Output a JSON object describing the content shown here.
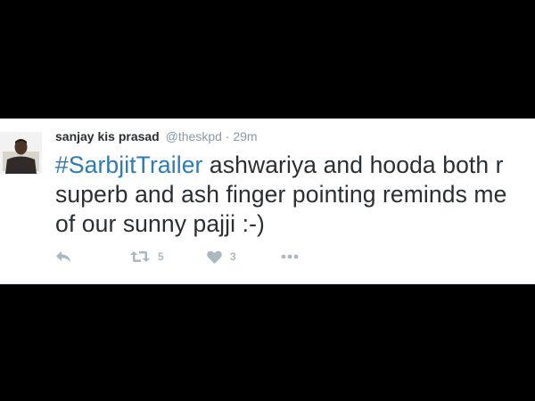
{
  "tweet": {
    "display_name": "sanjay kis prasad",
    "handle": "@theskpd",
    "separator": "·",
    "time": "29m",
    "hashtag": "#SarbjitTrailer",
    "text": " ashwariya and hooda both r superb and ash finger pointing reminds me of our sunny pajji :-)",
    "actions": {
      "reply_icon": "reply-icon",
      "retweet_icon": "retweet-icon",
      "retweet_count": "5",
      "like_icon": "heart-icon",
      "like_count": "3",
      "more_icon": "more-icon"
    }
  },
  "colors": {
    "background": "#000000",
    "card": "#ffffff",
    "hashtag": "#2b7bb9",
    "muted": "#8899a6",
    "action": "#aab8c2"
  }
}
